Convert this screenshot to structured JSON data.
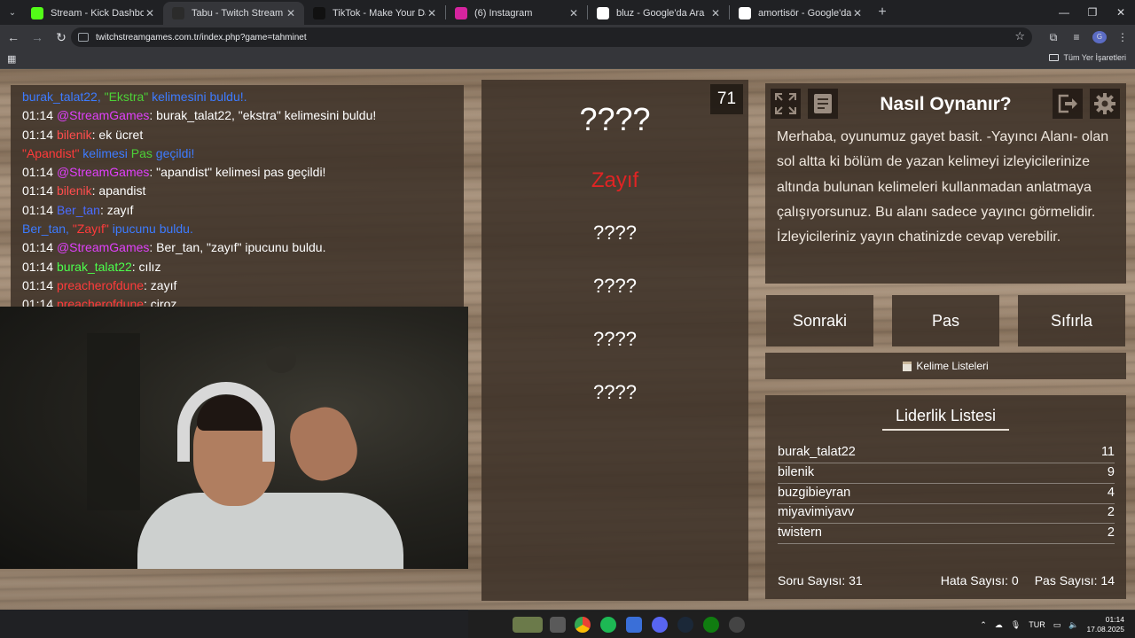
{
  "browser": {
    "tabs": [
      {
        "title": "Stream - Kick Dashboard",
        "favicon": "kick-icon",
        "color": "#53fc18"
      },
      {
        "title": "Tabu - Twitch Stream Games",
        "favicon": "twitch-games-icon",
        "color": "#2b2b2b",
        "active": true
      },
      {
        "title": "TikTok - Make Your Day",
        "favicon": "tiktok-icon",
        "color": "#111111"
      },
      {
        "title": "(6) Instagram",
        "favicon": "instagram-icon",
        "color": "#d6249f"
      },
      {
        "title": "bluz - Google'da Ara",
        "favicon": "google-icon",
        "color": "#ffffff"
      },
      {
        "title": "amortisör - Google'da Ara",
        "favicon": "google-icon",
        "color": "#ffffff"
      }
    ],
    "url": "twitchstreamgames.com.tr/index.php?game=tahminet",
    "bookmarks_label": "Tüm Yer İşaretleri",
    "profile_initial": "G"
  },
  "chat": {
    "lines": [
      {
        "parts": [
          {
            "t": "burak_talat22, ",
            "c": "#3d7bff"
          },
          {
            "t": "\"Ekstra\"",
            "c": "#4cd137"
          },
          {
            "t": " kelimesini buldu!.",
            "c": "#3d7bff"
          }
        ]
      },
      {
        "time": "01:14",
        "parts": [
          {
            "t": "@StreamGames",
            "c": "#e040fb"
          },
          {
            "t": ": burak_talat22, \"ekstra\" kelimesini buldu!",
            "c": "#ffffff"
          }
        ]
      },
      {
        "time": "01:14",
        "parts": [
          {
            "t": "bilenik",
            "c": "#ff4d4d"
          },
          {
            "t": ": ek ücret",
            "c": "#ffffff"
          }
        ]
      },
      {
        "parts": [
          {
            "t": "\"Apandist\"",
            "c": "#ff3b3b"
          },
          {
            "t": " kelimesi ",
            "c": "#3d7bff"
          },
          {
            "t": "Pas",
            "c": "#4cd137"
          },
          {
            "t": " geçildi!",
            "c": "#3d7bff"
          }
        ]
      },
      {
        "time": "01:14",
        "parts": [
          {
            "t": "@StreamGames",
            "c": "#e040fb"
          },
          {
            "t": ": \"apandist\" kelimesi pas geçildi!",
            "c": "#ffffff"
          }
        ]
      },
      {
        "time": "01:14",
        "parts": [
          {
            "t": "bilenik",
            "c": "#ff4d4d"
          },
          {
            "t": ": apandist",
            "c": "#ffffff"
          }
        ]
      },
      {
        "time": "01:14",
        "parts": [
          {
            "t": "Ber_tan",
            "c": "#4a6cff"
          },
          {
            "t": ": zayıf",
            "c": "#ffffff"
          }
        ]
      },
      {
        "parts": [
          {
            "t": "Ber_tan, ",
            "c": "#3d7bff"
          },
          {
            "t": "\"Zayıf\"",
            "c": "#ff3b3b"
          },
          {
            "t": " ipucunu buldu.",
            "c": "#3d7bff"
          }
        ]
      },
      {
        "time": "01:14",
        "parts": [
          {
            "t": "@StreamGames",
            "c": "#e040fb"
          },
          {
            "t": ": Ber_tan, \"zayıf\" ipucunu buldu.",
            "c": "#ffffff"
          }
        ]
      },
      {
        "time": "01:14",
        "parts": [
          {
            "t": "burak_talat22",
            "c": "#4cff4c"
          },
          {
            "t": ": cılız",
            "c": "#ffffff"
          }
        ]
      },
      {
        "time": "01:14",
        "parts": [
          {
            "t": "preacherofdune",
            "c": "#ff3b3b"
          },
          {
            "t": ": zayıf",
            "c": "#ffffff"
          }
        ]
      },
      {
        "time": "01:14",
        "parts": [
          {
            "t": "preacherofdune",
            "c": "#ff3b3b"
          },
          {
            "t": ": çiroz",
            "c": "#ffffff"
          }
        ]
      }
    ]
  },
  "game": {
    "timer": "71",
    "main_word": "????",
    "hints": [
      "Zayıf",
      "????",
      "????",
      "????",
      "????"
    ]
  },
  "howto": {
    "title": "Nasıl Oynanır?",
    "text": "Merhaba, oyunumuz gayet basit. -Yayıncı Alanı- olan sol altta ki bölüm de yazan kelimeyi izleyicilerinize altında bulunan kelimeleri kullanmadan anlatmaya çalışıyorsunuz. Bu alanı sadece yayıncı görmelidir. İzleyicileriniz yayın chatinizde cevap verebilir."
  },
  "buttons": {
    "next": "Sonraki",
    "pass": "Pas",
    "reset": "Sıfırla",
    "word_lists": "Kelime Listeleri"
  },
  "leaderboard": {
    "title": "Liderlik Listesi",
    "rows": [
      {
        "name": "burak_talat22",
        "score": "11"
      },
      {
        "name": "bilenik",
        "score": "9"
      },
      {
        "name": "buzgibieyran",
        "score": "4"
      },
      {
        "name": "miyavimiyavv",
        "score": "2"
      },
      {
        "name": "twistern",
        "score": "2"
      }
    ],
    "question_count": "Soru Sayısı: 31",
    "error_count": "Hata Sayısı: 0",
    "pass_count": "Pas Sayısı: 14"
  },
  "taskbar": {
    "lang": "TUR",
    "time": "01:14",
    "date": "17.08.2025"
  }
}
